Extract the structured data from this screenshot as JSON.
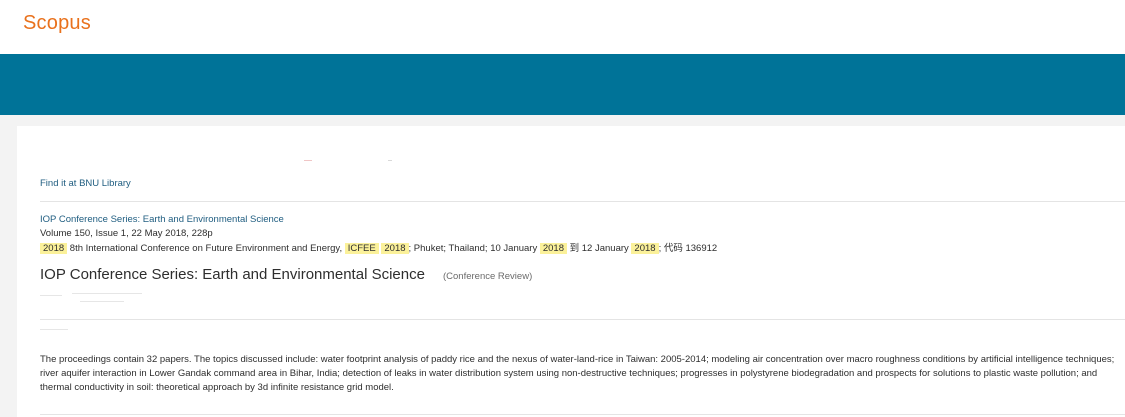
{
  "app": {
    "logo": "Scopus"
  },
  "colors": {
    "brand": "#e9711c",
    "banner": "#007398",
    "link": "#1f5d80",
    "highlight": "#fbf19a"
  },
  "document": {
    "library_link": "Find it at BNU Library",
    "source_title": "IOP Conference Series: Earth and Environmental Science",
    "volume_info": "Volume 150, Issue 1, 22 May 2018, 228p",
    "conference": {
      "year_highlight": "2018",
      "name_text": "8th International Conference on Future Environment and Energy,",
      "acronym_highlight": "ICFEE",
      "acronym_year_highlight": "2018",
      "location_text": "; Phuket; Thailand; 10 January",
      "start_year_highlight": "2018",
      "to_text": "到 12 January",
      "end_year_highlight": "2018",
      "code_text": "; 代码 136912"
    },
    "title": "IOP Conference Series: Earth and Environmental Science",
    "type": "(Conference Review)",
    "abstract": "The proceedings contain 32 papers. The topics discussed include: water footprint analysis of paddy rice and the nexus of water-land-rice in Taiwan: 2005-2014; modeling air concentration over macro roughness conditions by artificial intelligence techniques; river aquifer interaction in Lower Gandak command area in Bihar, India; detection of leaks in water distribution system using non-destructive techniques; progresses in polystyrene biodegradation and prospects for solutions to plastic waste pollution; and thermal conductivity in soil: theoretical approach by 3d infinite resistance grid model."
  }
}
